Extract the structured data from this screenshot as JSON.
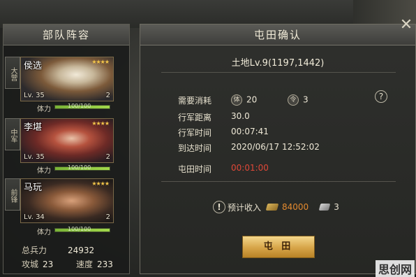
{
  "team": {
    "title": "部队阵容",
    "slots": [
      {
        "role": "大营",
        "name": "侯选",
        "stars": "★★★★",
        "level": "Lv. 35",
        "corner": "2",
        "stamina_label": "体力",
        "stamina_text": "100/100",
        "stamina": 100
      },
      {
        "role": "中军",
        "name": "李堪",
        "stars": "★★★★",
        "level": "Lv. 35",
        "corner": "2",
        "stamina_label": "体力",
        "stamina_text": "100/100",
        "stamina": 100
      },
      {
        "role": "前锋",
        "name": "马玩",
        "stars": "★★★★",
        "level": "Lv. 34",
        "corner": "2",
        "stamina_label": "体力",
        "stamina_text": "100/100",
        "stamina": 100
      }
    ],
    "stats": {
      "total_troops_label": "总兵力",
      "total_troops": "24932",
      "siege_label": "攻城",
      "siege": "23",
      "speed_label": "速度",
      "speed": "233"
    }
  },
  "dialog": {
    "title": "屯田确认",
    "land": "土地Lv.9(1197,1442)",
    "cost_label": "需要消耗",
    "cost_primary_icon": "体",
    "cost_primary": "20",
    "cost_secondary_icon": "令",
    "cost_secondary": "3",
    "distance_label": "行军距离",
    "distance": "30.0",
    "march_time_label": "行军时间",
    "march_time": "00:07:41",
    "arrival_label": "到达时间",
    "arrival": "2020/06/17 12:52:02",
    "farm_time_label": "屯田时间",
    "farm_time": "00:01:00",
    "help_label": "?",
    "warn_label": "!",
    "income_label": "预计收入",
    "income_copper": "84000",
    "income_item": "3",
    "confirm_label": "屯 田",
    "close_label": "✕"
  },
  "watermark": "思创网",
  "colors": {
    "accent_gold": "#d6a448",
    "time_red": "#e04838",
    "copper": "#e38a2e",
    "stamina_green": "#8ac43f"
  }
}
